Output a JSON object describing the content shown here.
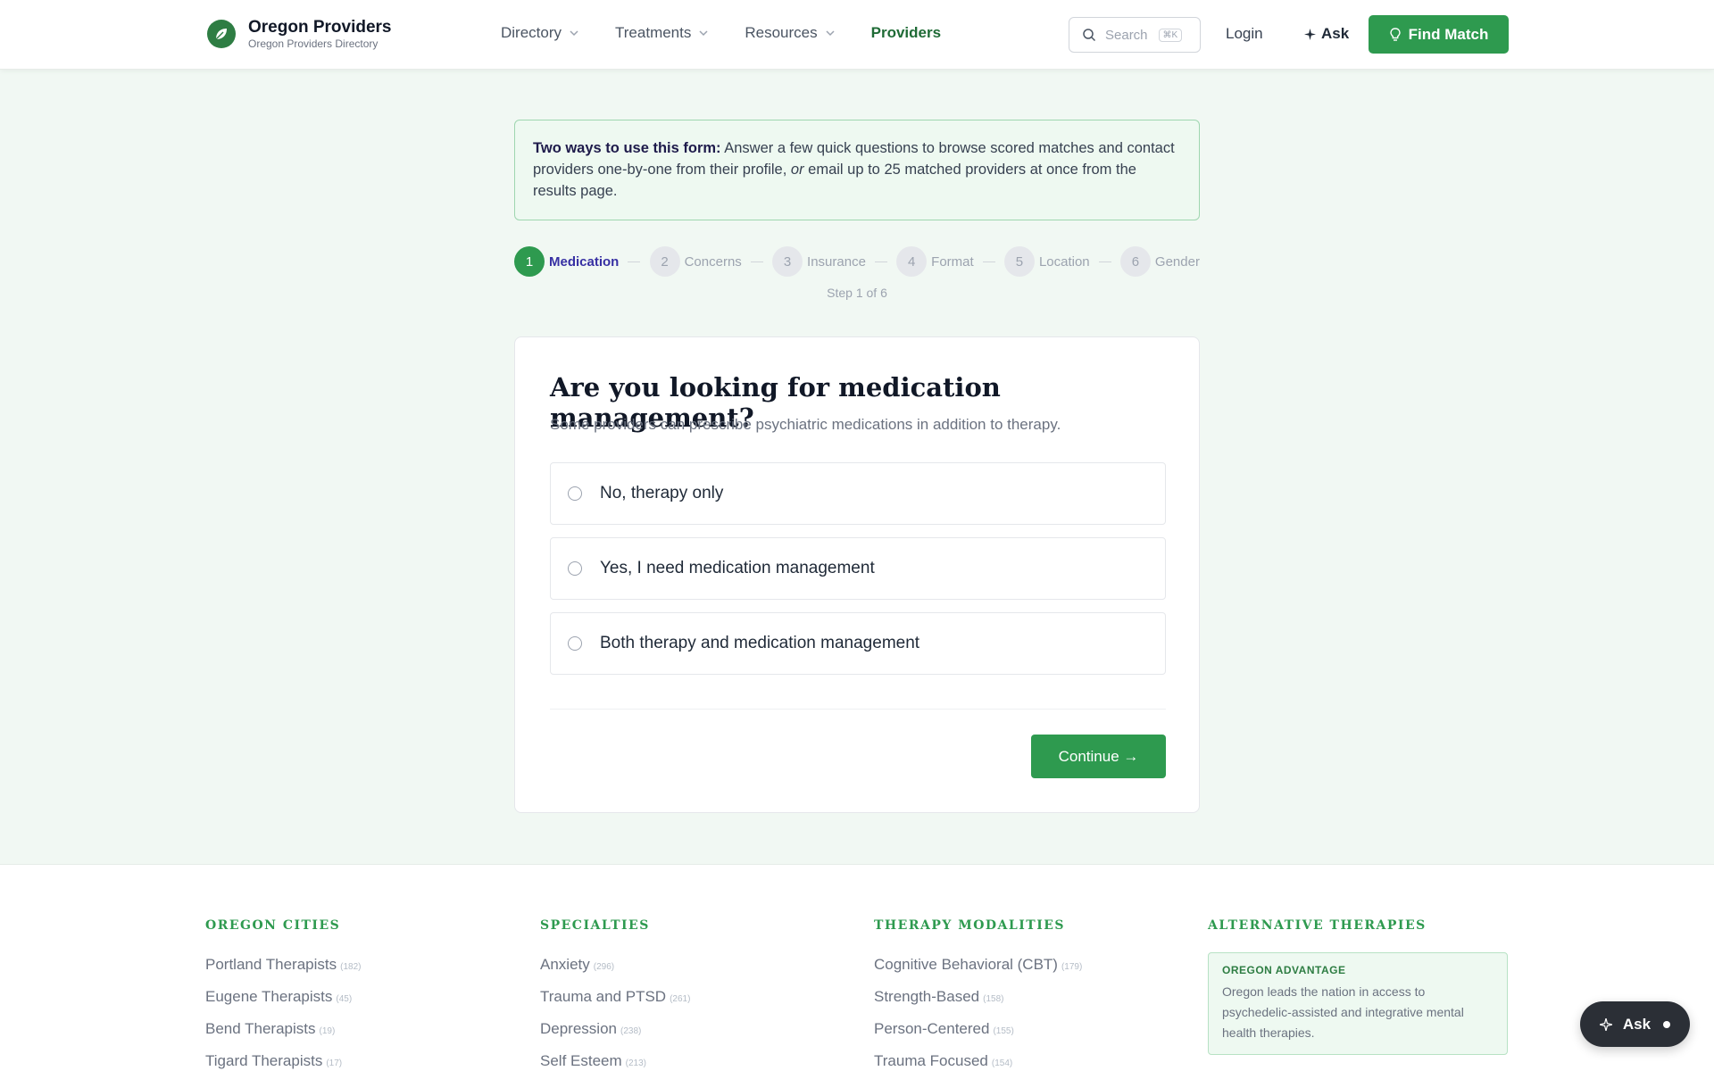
{
  "header": {
    "brand_title": "Oregon Providers",
    "brand_subtitle": "Oregon Providers Directory",
    "logo_icon": "leaf-icon",
    "nav": [
      {
        "label": "Directory",
        "has_dropdown": true
      },
      {
        "label": "Treatments",
        "has_dropdown": true
      },
      {
        "label": "Resources",
        "has_dropdown": true
      },
      {
        "label": "Providers",
        "has_dropdown": false,
        "active": true
      }
    ],
    "search_placeholder": "Search",
    "search_shortcut": "⌘K",
    "login_label": "Login",
    "ask_label": "Ask",
    "find_match_label": "Find Match"
  },
  "info": {
    "lead": "Two ways to use this form:",
    "text_before": " Answer a few quick questions to browse scored matches and contact providers one-by-one from their profile, ",
    "emph": "or",
    "text_after": " email up to 25 matched providers at once from the results page."
  },
  "stepper": {
    "steps": [
      {
        "num": "1",
        "label": "Medication"
      },
      {
        "num": "2",
        "label": "Concerns"
      },
      {
        "num": "3",
        "label": "Insurance"
      },
      {
        "num": "4",
        "label": "Format"
      },
      {
        "num": "5",
        "label": "Location"
      },
      {
        "num": "6",
        "label": "Gender"
      }
    ],
    "current": 1,
    "counter": "Step 1 of 6"
  },
  "question": {
    "title": "Are you looking for medication management?",
    "subtitle": "Some providers can prescribe psychiatric medications in addition to therapy.",
    "options": [
      "No, therapy only",
      "Yes, I need medication management",
      "Both therapy and medication management"
    ],
    "continue_label": "Continue →"
  },
  "footer": {
    "cities": {
      "heading": "OREGON CITIES",
      "items": [
        {
          "label": "Portland Therapists",
          "count": "(182)"
        },
        {
          "label": "Eugene Therapists",
          "count": "(45)"
        },
        {
          "label": "Bend Therapists",
          "count": "(19)"
        },
        {
          "label": "Tigard Therapists",
          "count": "(17)"
        }
      ]
    },
    "specialties": {
      "heading": "SPECIALTIES",
      "items": [
        {
          "label": "Anxiety",
          "count": "(296)"
        },
        {
          "label": "Trauma and PTSD",
          "count": "(261)"
        },
        {
          "label": "Depression",
          "count": "(238)"
        },
        {
          "label": "Self Esteem",
          "count": "(213)"
        }
      ]
    },
    "modalities": {
      "heading": "THERAPY MODALITIES",
      "items": [
        {
          "label": "Cognitive Behavioral (CBT)",
          "count": "(179)"
        },
        {
          "label": "Strength-Based",
          "count": "(158)"
        },
        {
          "label": "Person-Centered",
          "count": "(155)"
        },
        {
          "label": "Trauma Focused",
          "count": "(154)"
        }
      ]
    },
    "alternative": {
      "heading": "ALTERNATIVE THERAPIES",
      "box_heading": "OREGON ADVANTAGE",
      "box_text": "Oregon leads the nation in access to psychedelic-assisted and integrative mental health therapies."
    }
  },
  "floating_ask_label": "Ask",
  "colors": {
    "brand_green": "#2e9a4f",
    "active_step_label": "#3730a3",
    "page_bg": "#f1f8f3"
  }
}
